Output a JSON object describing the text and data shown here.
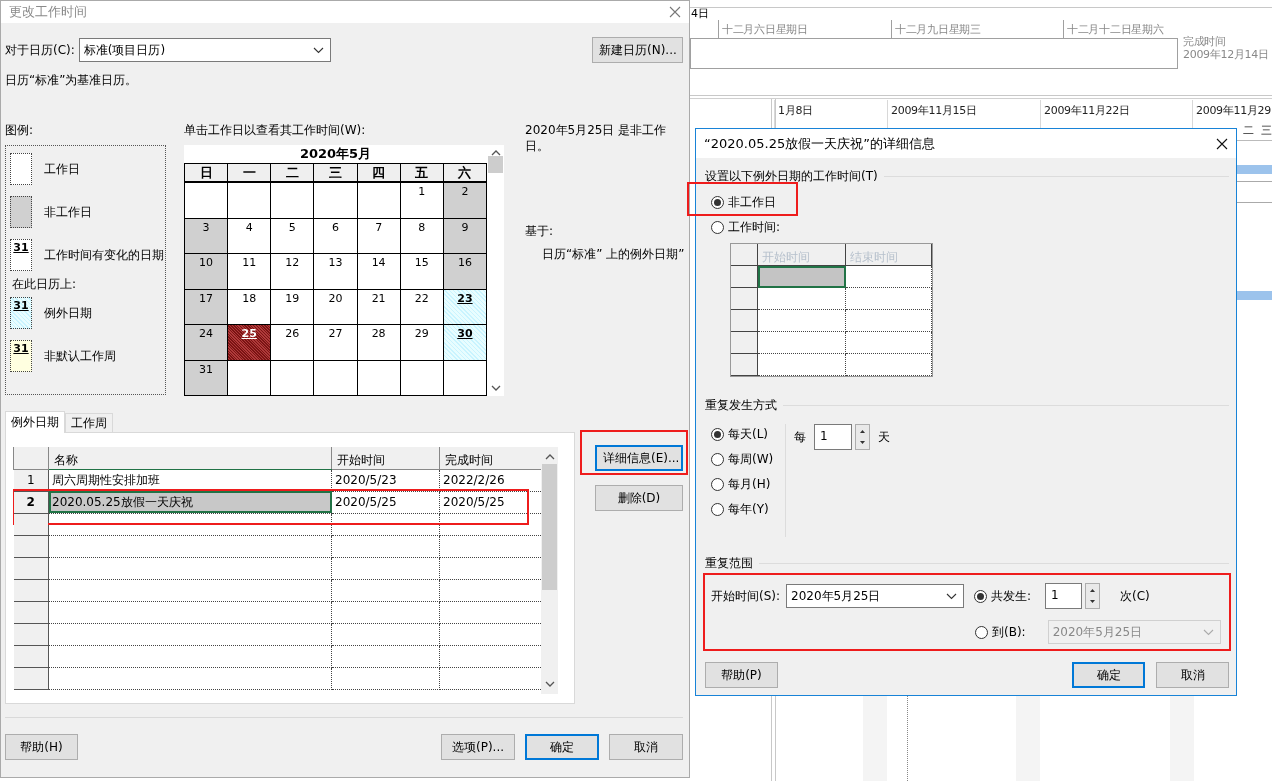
{
  "gantt": {
    "top_date": "4日",
    "timescale": [
      "十二月六日星期日",
      "十二月九日星期三",
      "十二月十二日星期六"
    ],
    "finish_label": "完成时间",
    "finish_date": "2009年12月14日",
    "week_labels": [
      "1月8日",
      "2009年11月15日",
      "2009年11月22日",
      "2009年11月29"
    ],
    "day_letters": [
      "二",
      "三"
    ]
  },
  "change_working_time": {
    "title": "更改工作时间",
    "calendar_label": "对于日历(C):",
    "calendar_value": "标准(项目日历)",
    "new_calendar_button": "新建日历(N)...",
    "base_note": "日历“标准”为基准日历。",
    "legend": {
      "title": "图例:",
      "items": [
        {
          "kind": "working",
          "label": "工作日"
        },
        {
          "kind": "nonworking",
          "label": "非工作日"
        },
        {
          "kind": "changed",
          "sample": "31",
          "label": "工作时间有变化的日期"
        },
        {
          "kind": "heading",
          "label": "在此日历上:"
        },
        {
          "kind": "exception",
          "sample": "31",
          "label": "例外日期"
        },
        {
          "kind": "nondefault_week",
          "sample": "31",
          "label": "非默认工作周"
        }
      ]
    },
    "calendar": {
      "label": "单击工作日以查看其工作时间(W):",
      "month": "2020年5月",
      "weekdays": [
        "日",
        "一",
        "二",
        "三",
        "四",
        "五",
        "六"
      ],
      "weeks": [
        [
          {
            "kind": "blank"
          },
          {
            "kind": "blank"
          },
          {
            "kind": "blank"
          },
          {
            "kind": "blank"
          },
          {
            "kind": "blank"
          },
          {
            "day": "1",
            "kind": "working",
            "selected": false
          },
          {
            "day": "2",
            "kind": "nonworking",
            "selected": false
          }
        ],
        [
          {
            "day": "3",
            "kind": "nonworking",
            "selected": false
          },
          {
            "day": "4",
            "kind": "working",
            "selected": false
          },
          {
            "day": "5",
            "kind": "working",
            "selected": false
          },
          {
            "day": "6",
            "kind": "working",
            "selected": false
          },
          {
            "day": "7",
            "kind": "working",
            "selected": false
          },
          {
            "day": "8",
            "kind": "working",
            "selected": false
          },
          {
            "day": "9",
            "kind": "nonworking",
            "selected": false
          }
        ],
        [
          {
            "day": "10",
            "kind": "nonworking",
            "selected": false
          },
          {
            "day": "11",
            "kind": "working",
            "selected": false
          },
          {
            "day": "12",
            "kind": "working",
            "selected": false
          },
          {
            "day": "13",
            "kind": "working",
            "selected": false
          },
          {
            "day": "14",
            "kind": "working",
            "selected": false
          },
          {
            "day": "15",
            "kind": "working",
            "selected": false
          },
          {
            "day": "16",
            "kind": "nonworking",
            "selected": false
          }
        ],
        [
          {
            "day": "17",
            "kind": "nonworking",
            "selected": false
          },
          {
            "day": "18",
            "kind": "working",
            "selected": false
          },
          {
            "day": "19",
            "kind": "working",
            "selected": false
          },
          {
            "day": "20",
            "kind": "working",
            "selected": false
          },
          {
            "day": "21",
            "kind": "working",
            "selected": false
          },
          {
            "day": "22",
            "kind": "working",
            "selected": false
          },
          {
            "day": "23",
            "kind": "exception",
            "selected": false
          }
        ],
        [
          {
            "day": "24",
            "kind": "nonworking",
            "selected": false
          },
          {
            "day": "25",
            "kind": "exception",
            "selected": true
          },
          {
            "day": "26",
            "kind": "working",
            "selected": false
          },
          {
            "day": "27",
            "kind": "working",
            "selected": false
          },
          {
            "day": "28",
            "kind": "working",
            "selected": false
          },
          {
            "day": "29",
            "kind": "working",
            "selected": false
          },
          {
            "day": "30",
            "kind": "exception",
            "selected": false
          }
        ],
        [
          {
            "day": "31",
            "kind": "nonworking",
            "selected": false
          },
          {
            "kind": "blank"
          },
          {
            "kind": "blank"
          },
          {
            "kind": "blank"
          },
          {
            "kind": "blank"
          },
          {
            "kind": "blank"
          },
          {
            "kind": "blank"
          }
        ]
      ]
    },
    "day_info": "2020年5月25日 是非工作日。",
    "based_on_label": "基于:",
    "based_on_text": "日历“标准” 上的例外日期”",
    "tabs": [
      {
        "label": "例外日期",
        "selected": true
      },
      {
        "label": "工作周",
        "selected": false
      }
    ],
    "exceptions": {
      "columns": [
        "名称",
        "开始时间",
        "完成时间"
      ],
      "rows": [
        {
          "number": "1",
          "name": "周六周期性安排加班",
          "start": "2020/5/23",
          "finish": "2022/2/26",
          "selected": false,
          "highlighted": false
        },
        {
          "number": "2",
          "name": "2020.05.25放假一天庆祝",
          "start": "2020/5/25",
          "finish": "2020/5/25",
          "selected": true,
          "highlighted": true
        }
      ]
    },
    "side_buttons": [
      {
        "label": "详细信息(E)...",
        "focused": true,
        "highlighted": true
      },
      {
        "label": "删除(D)",
        "focused": false,
        "highlighted": false
      }
    ],
    "footer_buttons": [
      {
        "label": "帮助(H)",
        "default": false
      },
      {
        "label": "选项(P)...",
        "default": false
      },
      {
        "label": "确定",
        "default": true
      },
      {
        "label": "取消",
        "default": false
      }
    ]
  },
  "details_dialog": {
    "title": "“2020.05.25放假一天庆祝”的详细信息",
    "working_time": {
      "group_label": "设置以下例外日期的工作时间(T)",
      "options": [
        {
          "label": "非工作日",
          "selected": true,
          "highlighted": true
        },
        {
          "label": "工作时间:",
          "selected": false,
          "highlighted": false
        }
      ],
      "columns": [
        "开始时间",
        "结束时间"
      ]
    },
    "recurrence": {
      "group_label": "重复发生方式",
      "options": [
        {
          "label": "每天(L)",
          "selected": true
        },
        {
          "label": "每周(W)",
          "selected": false
        },
        {
          "label": "每月(H)",
          "selected": false
        },
        {
          "label": "每年(Y)",
          "selected": false
        }
      ],
      "every_label": "每",
      "every_value": "1",
      "unit": "天"
    },
    "range": {
      "group_label": "重复范围",
      "highlighted": true,
      "start_label": "开始时间(S):",
      "start_value": "2020年5月25日",
      "options": [
        {
          "kind": "count",
          "label": "共发生:",
          "selected": true,
          "value": "1",
          "unit": "次(C)"
        },
        {
          "kind": "until",
          "label": "到(B):",
          "selected": false,
          "value": "2020年5月25日"
        }
      ]
    },
    "buttons": [
      {
        "label": "帮助(P)",
        "default": false
      },
      {
        "label": "确定",
        "default": true
      },
      {
        "label": "取消",
        "default": false
      }
    ]
  }
}
